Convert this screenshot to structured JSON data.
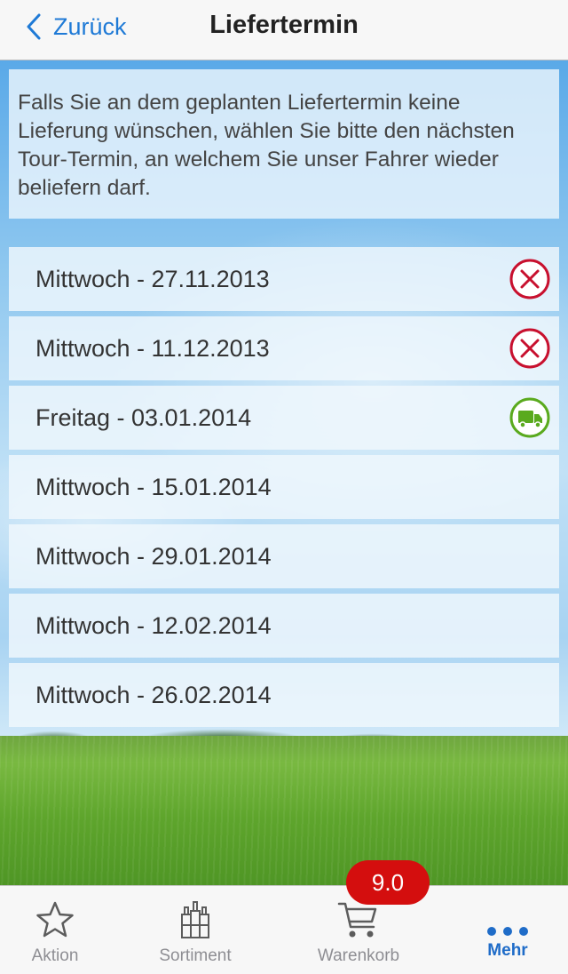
{
  "nav": {
    "back_label": "Zurück",
    "title": "Liefertermin"
  },
  "info": {
    "text": "Falls Sie an dem geplanten Liefertermin keine Lieferung wünschen, wählen Sie bitte den nächsten Tour-Termin, an welchem Sie unser Fahrer wieder beliefern darf."
  },
  "dates": [
    {
      "label": "Mittwoch - 27.11.2013",
      "status": "cancel-icon"
    },
    {
      "label": "Mittwoch - 11.12.2013",
      "status": "cancel-icon"
    },
    {
      "label": "Freitag - 03.01.2014",
      "status": "delivery-truck-icon"
    },
    {
      "label": "Mittwoch - 15.01.2014",
      "status": ""
    },
    {
      "label": "Mittwoch - 29.01.2014",
      "status": ""
    },
    {
      "label": "Mittwoch - 12.02.2014",
      "status": ""
    },
    {
      "label": "Mittwoch - 26.02.2014",
      "status": ""
    }
  ],
  "tabbar": {
    "tabs": [
      {
        "label": "Aktion",
        "icon": "star-icon"
      },
      {
        "label": "Sortiment",
        "icon": "bottles-icon"
      },
      {
        "label": "Warenkorb",
        "icon": "cart-icon"
      },
      {
        "label": "Mehr",
        "icon": "more-dots-icon"
      }
    ],
    "cart_badge": "9.0"
  },
  "colors": {
    "accent": "#1f6cc8",
    "cancel": "#c8102e",
    "delivery": "#5aaa1e",
    "badge": "#d40e0e"
  }
}
